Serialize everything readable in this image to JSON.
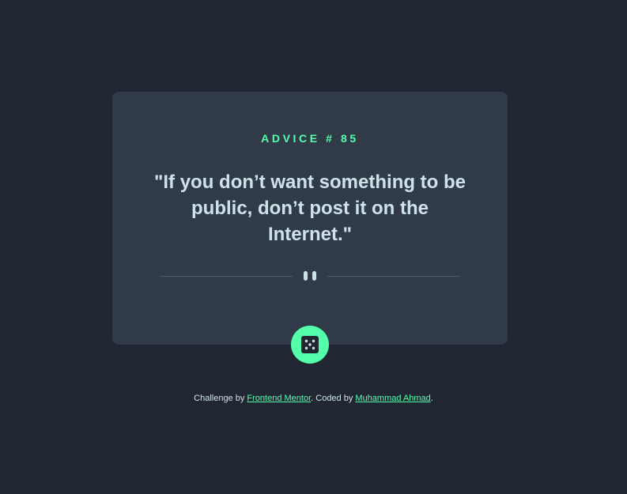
{
  "card": {
    "advice_label": "ADVICE # 85",
    "quote": "\"If you don’t want something to be public, don’t post it on the Internet.\""
  },
  "icons": {
    "divider": "pause-icon",
    "generate": "dice-icon"
  },
  "attribution": {
    "prefix": "Challenge by ",
    "challenge_link": "Frontend Mentor",
    "middle": ". Coded by ",
    "author_link": "Muhammad Ahmad",
    "suffix": "."
  },
  "colors": {
    "background": "#202733",
    "card": "#313a49",
    "accent": "#53ffaa",
    "text": "#cee3e9",
    "divider": "#4f5d74"
  }
}
